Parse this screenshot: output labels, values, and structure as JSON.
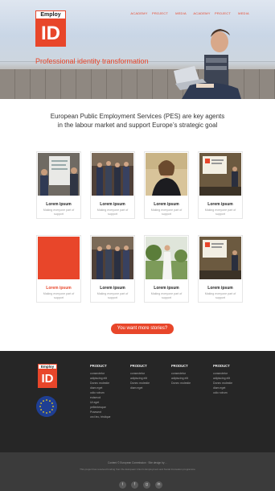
{
  "logo": {
    "top": "Employ",
    "big": "ID"
  },
  "nav": [
    "ACADEMY",
    "PROJECT",
    "MEDIA",
    "ACADEMY",
    "PROJECT",
    "MEDIA"
  ],
  "hero": {
    "title": "Professional identity transformation"
  },
  "intro": {
    "line1": "European Public Employment Services (PES) are key agents",
    "line2": "in the labour market and support Europe’s strategic goal"
  },
  "cards": [
    {
      "title": "Lorem ipsum",
      "sub": "Making everyone part of support"
    },
    {
      "title": "Lorem ipsum",
      "sub": "Making everyone part of support"
    },
    {
      "title": "Lorem ipsum",
      "sub": "Making everyone part of support"
    },
    {
      "title": "Lorem ipsum",
      "sub": "Making everyone part of support"
    },
    {
      "title": "Lorem ipsum",
      "sub": "Making everyone part of support"
    },
    {
      "title": "Lorem ipsum",
      "sub": "Making everyone part of support"
    },
    {
      "title": "Lorem ipsum",
      "sub": "Making everyone part of support"
    },
    {
      "title": "Lorem ipsum",
      "sub": "Making everyone part of support"
    }
  ],
  "cta": {
    "label": "You want more stories?"
  },
  "footer": {
    "columns": [
      {
        "heading": "PRODUCT",
        "links": [
          "consectetur",
          "adipiscing elit",
          "Donec molestie",
          "diam eget",
          "odio rutrum",
          "euismod",
          "Ut eget",
          "pellentesque",
          "Praesent",
          "orci leo, tristique"
        ]
      },
      {
        "heading": "PRODUCT",
        "links": [
          "consectetur",
          "adipiscing elit",
          "Donec molestie",
          "diam eget"
        ]
      },
      {
        "heading": "PRODUCT",
        "links": [
          "consectetur",
          "adipiscing elit",
          "Donec molestie"
        ]
      },
      {
        "heading": "PRODUCT",
        "links": [
          "consectetur",
          "adipiscing elit",
          "Donec molestie",
          "diam eget",
          "odio rutrum"
        ]
      }
    ],
    "copyright": "Content © European Commission · Site design by ...",
    "copyright2": "This project has received funding from the European Union’s Employment and Social Innovation programme"
  },
  "social": [
    {
      "name": "twitter-icon",
      "glyph": "t"
    },
    {
      "name": "facebook-icon",
      "glyph": "f"
    },
    {
      "name": "google-plus-icon",
      "glyph": "g"
    },
    {
      "name": "linkedin-icon",
      "glyph": "in"
    }
  ],
  "colors": {
    "accent": "#e8462a",
    "footer": "#262626",
    "bottom": "#3b3b3b"
  }
}
